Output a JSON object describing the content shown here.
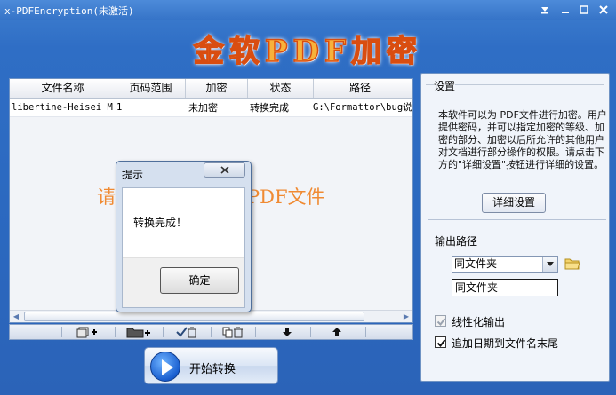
{
  "window": {
    "title": "x-PDFEncryption(未激活)"
  },
  "logo": {
    "text": "金软PDF加密"
  },
  "file_list": {
    "columns": [
      "文件名称",
      "页码范围",
      "加密",
      "状态",
      "路径"
    ],
    "rows": [
      {
        "name": "libertine-Heisei M..",
        "pages": "1",
        "encrypt": "未加密",
        "status": "转换完成",
        "path": "G:\\Formattor\\bug说明"
      }
    ],
    "hint_prefix": "请",
    "hint_suffix": "PDF文件"
  },
  "toolbar": {
    "icons": [
      "add-file-icon",
      "add-folder-icon",
      "clear-checked-icon",
      "clear-all-icon",
      "move-down-icon",
      "move-up-icon"
    ]
  },
  "start_button": {
    "label": "开始转换"
  },
  "settings": {
    "group_title": "设置",
    "description": "本软件可以为 PDF文件进行加密。用户提供密码，并可以指定加密的等级、加密的部分、加密以后所允许的其他用户对文档进行部分操作的权限。请点击下方的\"详细设置\"按钮进行详细的设置。",
    "detail_button": "详细设置",
    "output_label": "输出路径",
    "output_select": "同文件夹",
    "output_text": "同文件夹",
    "linearize_label": "线性化输出",
    "linearize_checked": true,
    "linearize_disabled": true,
    "append_date_label": "追加日期到文件名末尾",
    "append_date_checked": true
  },
  "dialog": {
    "title": "提示",
    "message": "转换完成！",
    "ok_button": "确定"
  }
}
